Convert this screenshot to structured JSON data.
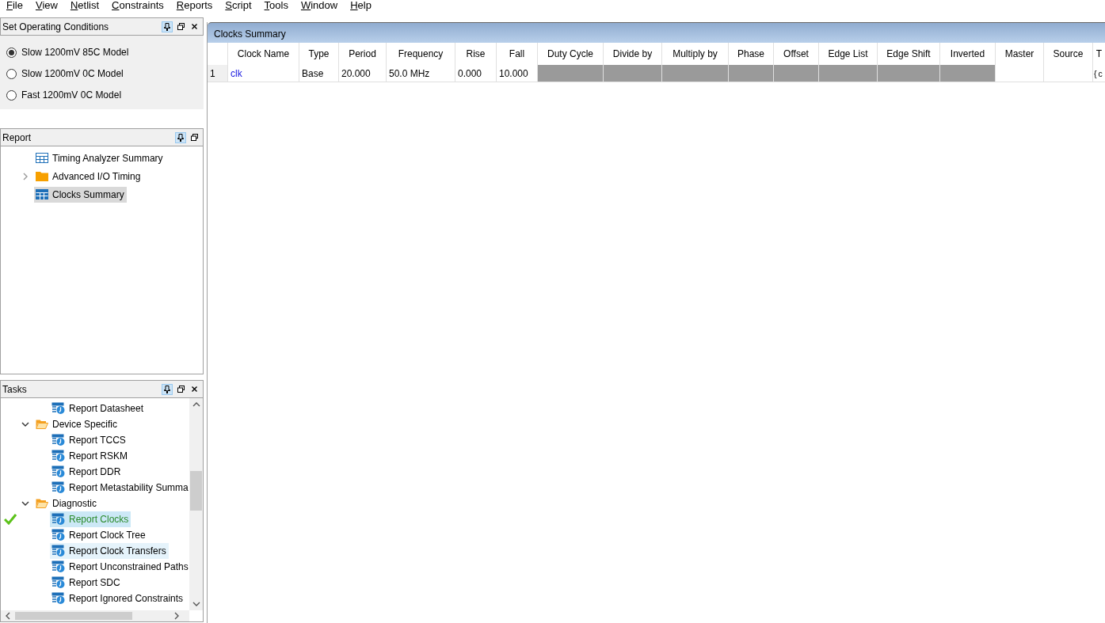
{
  "menu": [
    "File",
    "View",
    "Netlist",
    "Constraints",
    "Reports",
    "Script",
    "Tools",
    "Window",
    "Help"
  ],
  "operating_conditions": {
    "title": "Set Operating Conditions",
    "closable": true,
    "options": [
      {
        "label": "Slow 1200mV 85C Model",
        "selected": true
      },
      {
        "label": "Slow 1200mV 0C Model",
        "selected": false
      },
      {
        "label": "Fast 1200mV 0C Model",
        "selected": false
      }
    ]
  },
  "report": {
    "title": "Report",
    "closable": false,
    "items": [
      {
        "kind": "table",
        "label": "Timing Analyzer Summary",
        "selected": false
      },
      {
        "kind": "folder",
        "label": "Advanced I/O Timing",
        "selected": false,
        "expanded": false
      },
      {
        "kind": "table",
        "label": "Clocks Summary",
        "selected": true
      }
    ]
  },
  "tasks": {
    "title": "Tasks",
    "closable": true,
    "items": [
      {
        "kind": "task",
        "label": "Report Datasheet",
        "selected": false,
        "hovered": false,
        "done": false
      },
      {
        "kind": "folder",
        "label": "Device Specific",
        "expanded": true,
        "children": [
          {
            "kind": "task",
            "label": "Report TCCS",
            "selected": false,
            "hovered": false,
            "done": false
          },
          {
            "kind": "task",
            "label": "Report RSKM",
            "selected": false,
            "hovered": false,
            "done": false
          },
          {
            "kind": "task",
            "label": "Report DDR",
            "selected": false,
            "hovered": false,
            "done": false
          },
          {
            "kind": "task",
            "label": "Report Metastability Summa",
            "selected": false,
            "hovered": false,
            "done": false
          }
        ]
      },
      {
        "kind": "folder",
        "label": "Diagnostic",
        "expanded": true,
        "children": [
          {
            "kind": "task",
            "label": "Report Clocks",
            "selected": true,
            "hovered": false,
            "done": true
          },
          {
            "kind": "task",
            "label": "Report Clock Tree",
            "selected": false,
            "hovered": false,
            "done": false
          },
          {
            "kind": "task",
            "label": "Report Clock Transfers",
            "selected": false,
            "hovered": true,
            "done": false
          },
          {
            "kind": "task",
            "label": "Report Unconstrained Paths",
            "selected": false,
            "hovered": false,
            "done": false
          },
          {
            "kind": "task",
            "label": "Report SDC",
            "selected": false,
            "hovered": false,
            "done": false
          },
          {
            "kind": "task",
            "label": "Report Ignored Constraints",
            "selected": false,
            "hovered": false,
            "done": false
          }
        ]
      }
    ]
  },
  "clocks_summary": {
    "title": "Clocks Summary",
    "columns": [
      "Clock Name",
      "Type",
      "Period",
      "Frequency",
      "Rise",
      "Fall",
      "Duty Cycle",
      "Divide by",
      "Multiply by",
      "Phase",
      "Offset",
      "Edge List",
      "Edge Shift",
      "Inverted",
      "Master",
      "Source",
      "T"
    ],
    "rows": [
      {
        "number": "1",
        "cells": [
          {
            "kind": "link",
            "text": "clk"
          },
          {
            "kind": "text",
            "text": "Base"
          },
          {
            "kind": "text",
            "text": "20.000"
          },
          {
            "kind": "text",
            "text": "50.0 MHz"
          },
          {
            "kind": "text",
            "text": "0.000"
          },
          {
            "kind": "text",
            "text": "10.000"
          },
          {
            "kind": "na"
          },
          {
            "kind": "na"
          },
          {
            "kind": "na"
          },
          {
            "kind": "na"
          },
          {
            "kind": "na"
          },
          {
            "kind": "na"
          },
          {
            "kind": "na"
          },
          {
            "kind": "na"
          },
          {
            "kind": "empty"
          },
          {
            "kind": "empty"
          },
          {
            "kind": "text",
            "text": "{ c"
          }
        ]
      }
    ]
  }
}
